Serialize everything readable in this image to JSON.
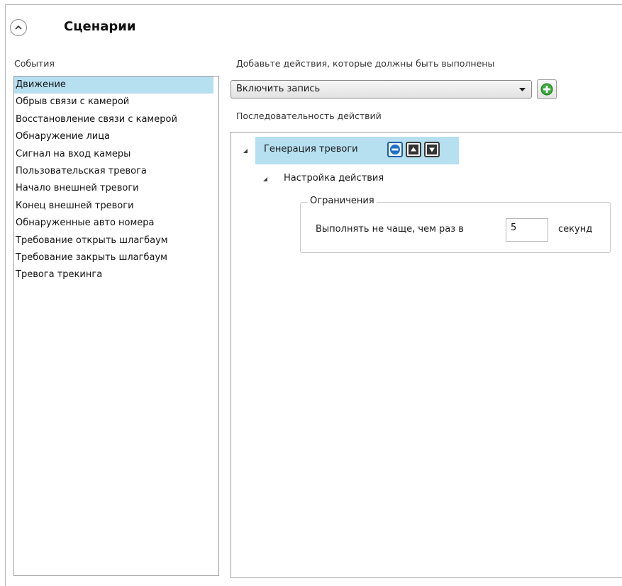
{
  "header": {
    "title": "Сценарии",
    "collapse_icon": "chevron-up-icon"
  },
  "events": {
    "label": "События",
    "items": [
      {
        "label": "Движение",
        "selected": true
      },
      {
        "label": "Обрыв связи с камерой"
      },
      {
        "label": "Восстановление связи с камерой"
      },
      {
        "label": "Обнаружение лица"
      },
      {
        "label": "Сигнал на вход камеры"
      },
      {
        "label": "Пользовательская тревога"
      },
      {
        "label": "Начало внешней тревоги"
      },
      {
        "label": "Конец внешней тревоги"
      },
      {
        "label": "Обнаруженные авто номера"
      },
      {
        "label": "Требование открыть шлагбаум"
      },
      {
        "label": "Требование закрыть шлагбаум"
      },
      {
        "label": "Тревога трекинга"
      }
    ]
  },
  "actions": {
    "add_label": "Добавьте действия, которые должны быть выполнены",
    "selected_action": "Включить запись",
    "add_icon": "plus-circle-icon",
    "sequence_label": "Последовательность действий"
  },
  "tree": {
    "node_label": "Генерация тревоги",
    "node_buttons": [
      "remove-icon",
      "move-up-icon",
      "move-down-icon"
    ],
    "child_label": "Настройка действия",
    "group_title": "Ограничения",
    "limit_label": "Выполнять не чаще, чем раз в",
    "limit_value": "5",
    "limit_unit": "секунд"
  },
  "colors": {
    "selection": "#b6dff0",
    "add_green": "#3cab3c",
    "remove_blue": "#1f6fc5"
  }
}
